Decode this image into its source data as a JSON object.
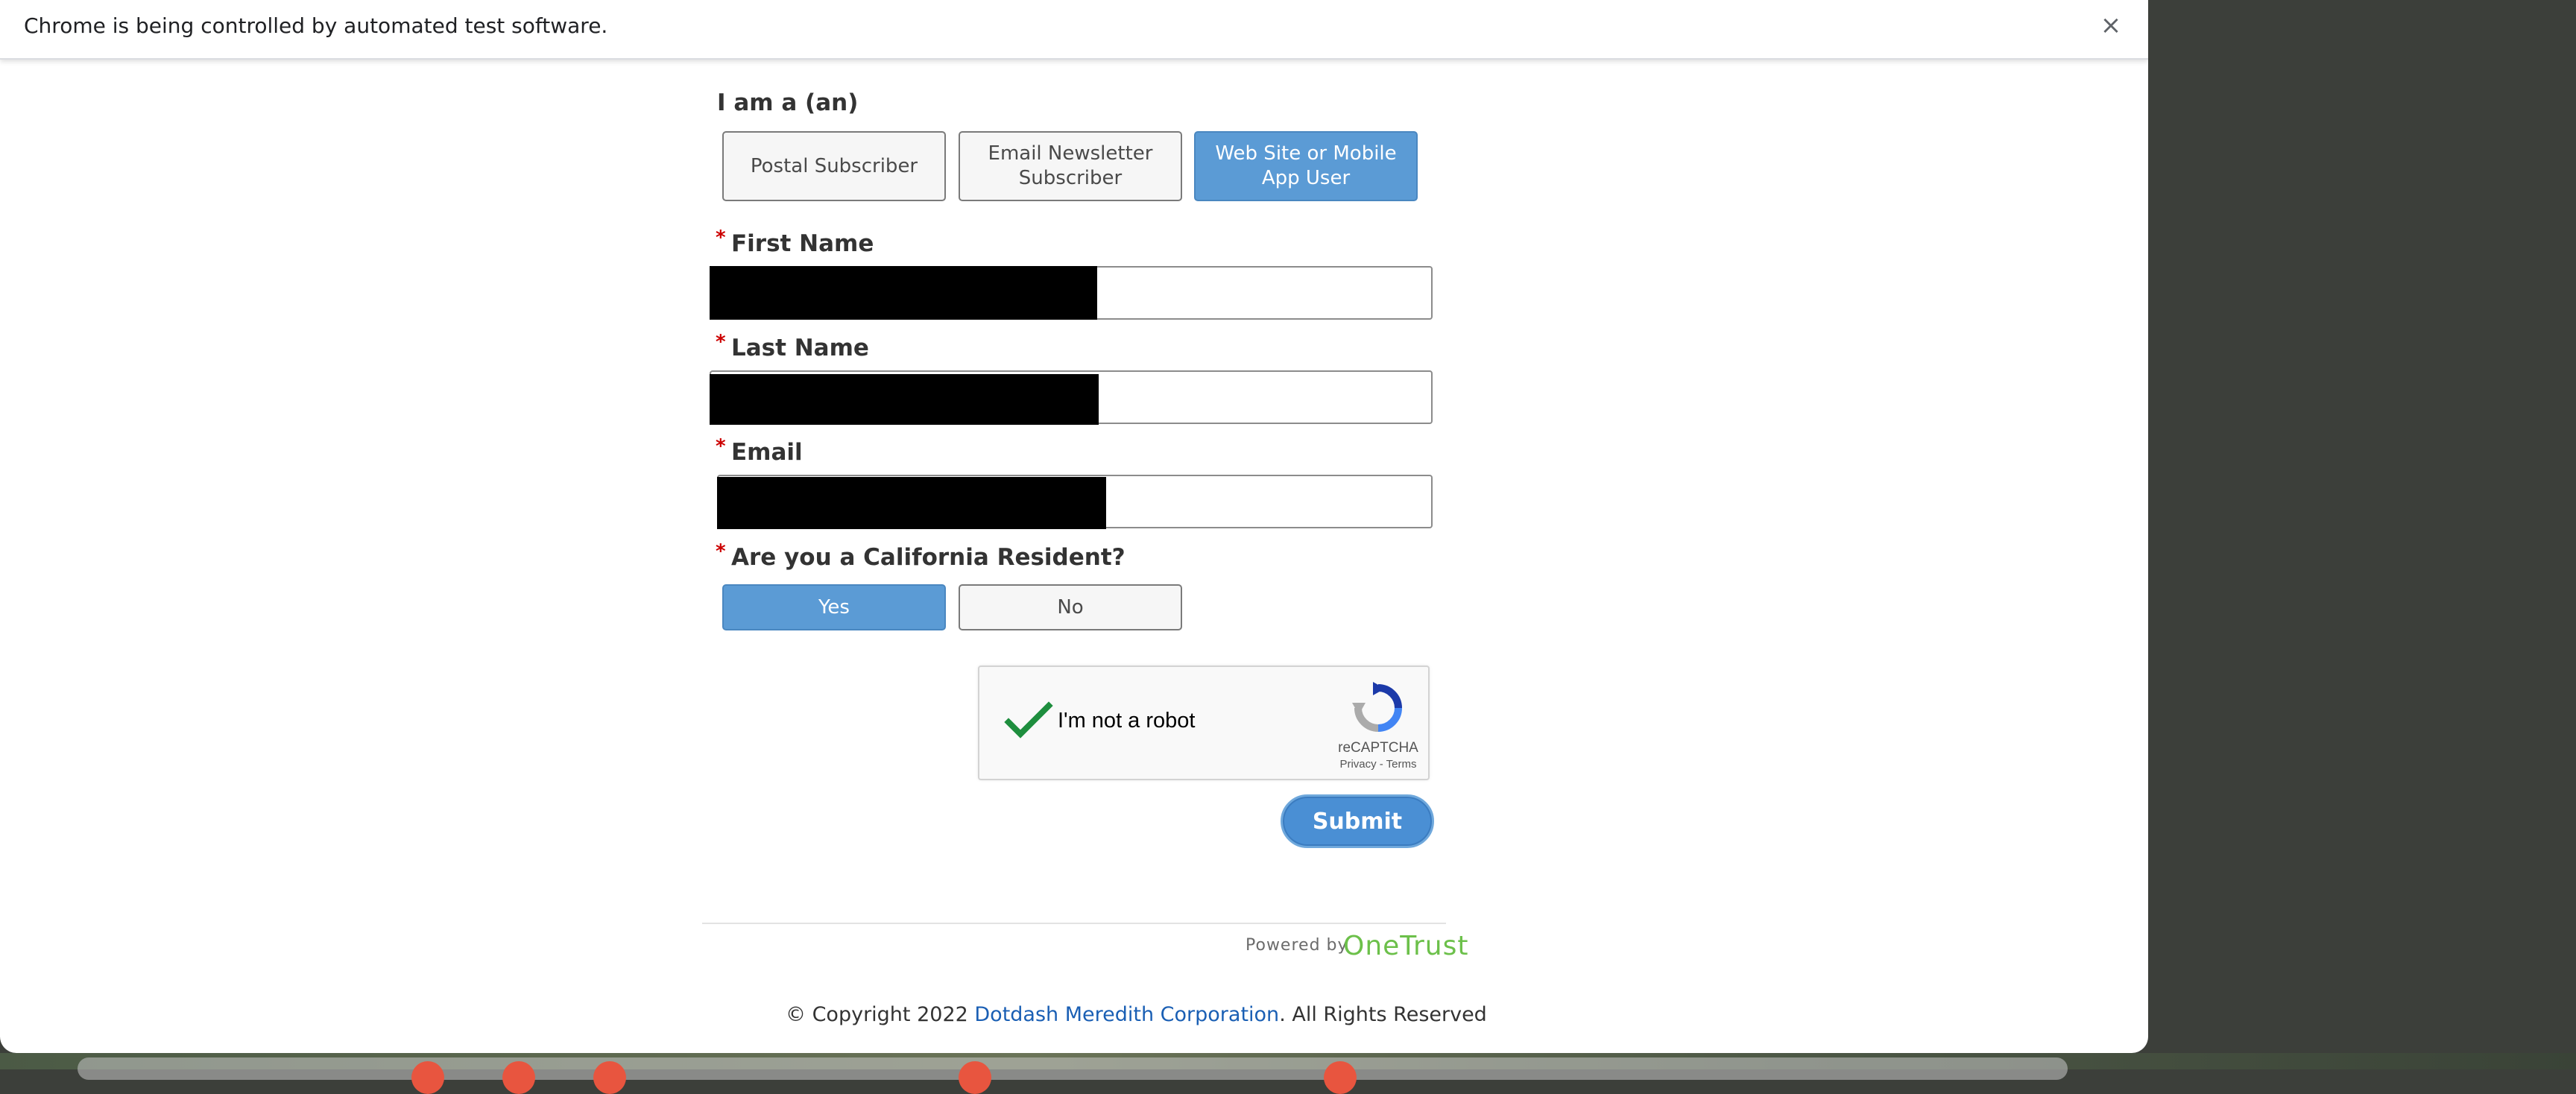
{
  "infobar": {
    "message": "Chrome is being controlled by automated test software.",
    "close_symbol": "×"
  },
  "form": {
    "type_label": "I am a (an)",
    "type_options": [
      {
        "label": "Postal Subscriber",
        "selected": false
      },
      {
        "label": "Email Newsletter Subscriber",
        "selected": false
      },
      {
        "label": "Web Site or Mobile App User",
        "selected": true
      }
    ],
    "required_mark": "*",
    "first_name_label": "First Name",
    "last_name_label": "Last Name",
    "email_label": "Email",
    "california_label": "Are you a California Resident?",
    "california_options": [
      {
        "label": "Yes",
        "selected": true
      },
      {
        "label": "No",
        "selected": false
      }
    ],
    "captcha": {
      "label": "I'm not a robot",
      "brand": "reCAPTCHA",
      "links": "Privacy - Terms",
      "checked": true
    },
    "submit_label": "Submit"
  },
  "footer": {
    "powered_by": "Powered by",
    "provider": "OneTrust",
    "copyright_prefix": "© Copyright 2022 ",
    "company_link": "Dotdash Meredith Corporation",
    "copyright_suffix": ". All Rights Reserved"
  },
  "colors": {
    "selected_option": "#5b9bd5",
    "submit": "#4a8fd4",
    "required": "#cc0000",
    "onetrust": "#6cc04a",
    "link": "#1a5fb4"
  }
}
